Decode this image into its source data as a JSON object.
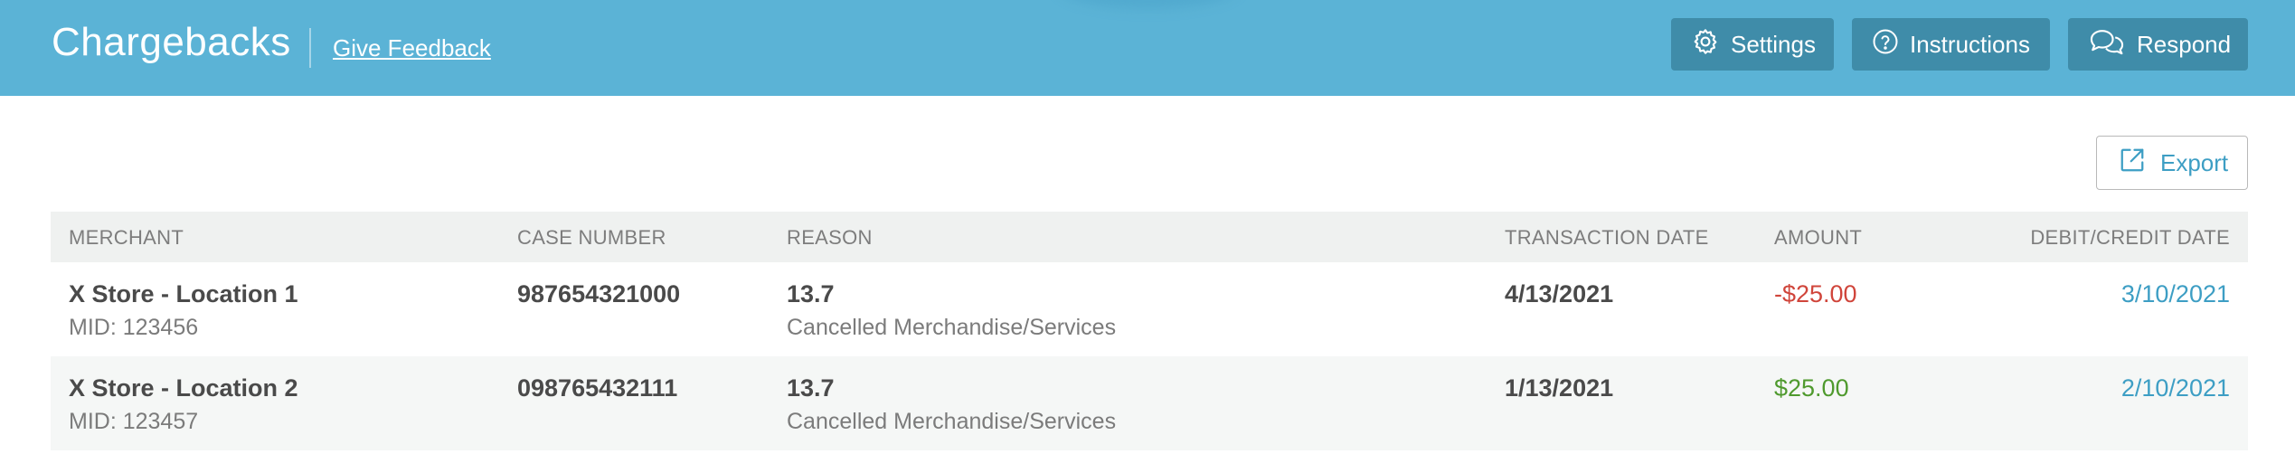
{
  "header": {
    "title": "Chargebacks",
    "feedback_link": "Give Feedback",
    "buttons": {
      "settings": "Settings",
      "instructions": "Instructions",
      "respond": "Respond"
    }
  },
  "toolbar": {
    "export_label": "Export"
  },
  "table": {
    "columns": {
      "merchant": "MERCHANT",
      "case_number": "CASE NUMBER",
      "reason": "REASON",
      "transaction_date": "TRANSACTION DATE",
      "amount": "AMOUNT",
      "debit_credit_date": "DEBIT/CREDIT DATE"
    },
    "rows": [
      {
        "merchant": "X Store - Location 1",
        "mid": "MID: 123456",
        "case_number": "987654321000",
        "reason_code": "13.7",
        "reason_desc": "Cancelled Merchandise/Services",
        "transaction_date": "4/13/2021",
        "amount": "-$25.00",
        "amount_color": "#d0453b",
        "debit_credit_date": "3/10/2021"
      },
      {
        "merchant": "X Store - Location 2",
        "mid": "MID: 123457",
        "case_number": "098765432111",
        "reason_code": "13.7",
        "reason_desc": "Cancelled Merchandise/Services",
        "transaction_date": "1/13/2021",
        "amount": "$25.00",
        "amount_color": "#4f9a2e",
        "debit_credit_date": "2/10/2021"
      }
    ]
  },
  "colors": {
    "header_bg": "#5bb3d6",
    "header_button_bg": "#3f8ca9",
    "accent_link": "#3d9ec4",
    "table_header_bg": "#eff1f0"
  }
}
